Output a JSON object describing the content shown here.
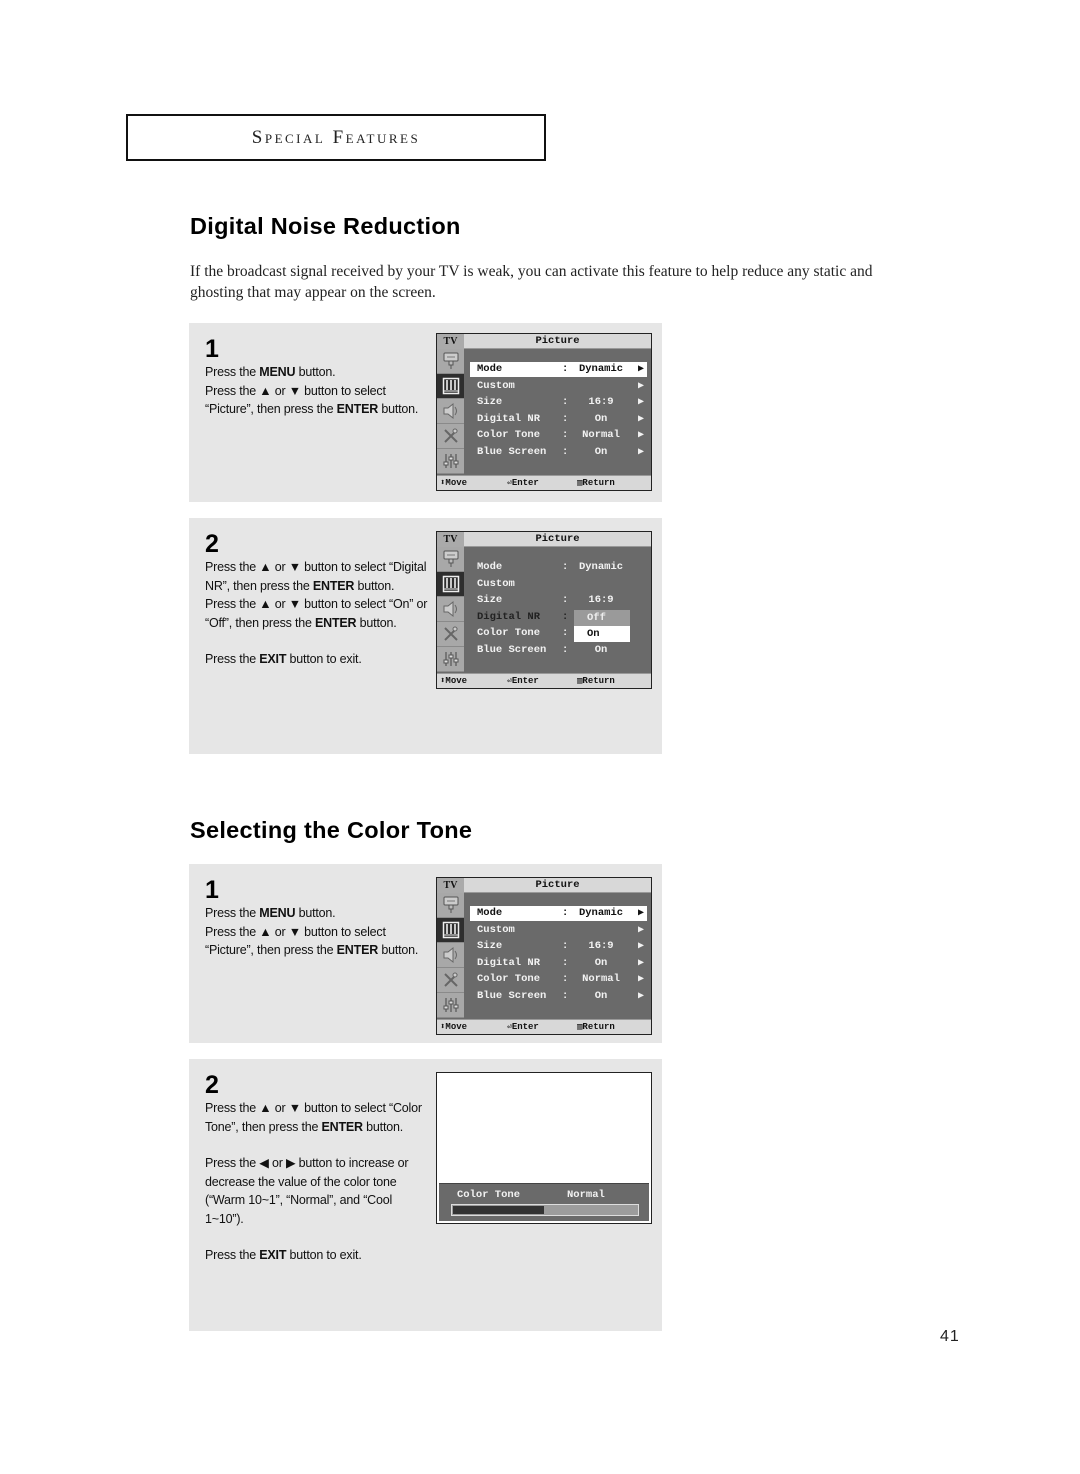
{
  "header": {
    "section": "Special Features"
  },
  "page_number": "41",
  "sections": [
    {
      "title": "Digital Noise Reduction",
      "intro": "If the broadcast signal received by your TV is weak, you can activate this feature to help reduce any static and ghosting that may appear on the screen.",
      "steps": [
        {
          "number": "1",
          "lines": [
            [
              "Press the ",
              {
                "b": "MENU"
              },
              " button."
            ],
            [
              "Press the ▲ or ▼ button to select “Picture”, then press the ",
              {
                "b": "ENTER"
              },
              " button."
            ]
          ],
          "osd": {
            "tv_label": "TV",
            "title": "Picture",
            "rows": [
              {
                "label": "Mode",
                "colon": ":",
                "value": "Dynamic",
                "arrow": "▶",
                "highlighted": true
              },
              {
                "label": "Custom",
                "colon": "",
                "value": "",
                "arrow": "▶"
              },
              {
                "label": "Size",
                "colon": ":",
                "value": "16:9",
                "arrow": "▶"
              },
              {
                "label": "Digital NR",
                "colon": ":",
                "value": "On",
                "arrow": "▶"
              },
              {
                "label": "Color Tone",
                "colon": ":",
                "value": "Normal",
                "arrow": "▶"
              },
              {
                "label": "Blue Screen",
                "colon": ":",
                "value": "On",
                "arrow": "▶"
              }
            ],
            "footer": {
              "move": "Move",
              "enter": "Enter",
              "return": "Return"
            }
          }
        },
        {
          "number": "2",
          "lines": [
            [
              "Press the ▲ or ▼ button to select “Digital NR”, then press the ",
              {
                "b": "ENTER"
              },
              " button."
            ],
            [
              "Press the ▲ or ▼ button to select “On” or “Off”, then press the ",
              {
                "b": "ENTER"
              },
              " button."
            ],
            [
              "GAP"
            ],
            [
              "Press the ",
              {
                "b": "EXIT"
              },
              " button to exit."
            ]
          ],
          "osd": {
            "tv_label": "TV",
            "title": "Picture",
            "rows": [
              {
                "label": "Mode",
                "colon": ":",
                "value": "Dynamic",
                "arrow": ""
              },
              {
                "label": "Custom",
                "colon": "",
                "value": "",
                "arrow": ""
              },
              {
                "label": "Size",
                "colon": ":",
                "value": "16:9",
                "arrow": ""
              },
              {
                "label": "Digital NR",
                "colon": ":",
                "value": "",
                "arrow": "",
                "dim": true
              },
              {
                "label": "Color Tone",
                "colon": ":",
                "value": "",
                "arrow": ""
              },
              {
                "label": "Blue Screen",
                "colon": ":",
                "value": "On",
                "arrow": ""
              }
            ],
            "dropdown": {
              "options": [
                "Off",
                "On"
              ],
              "selected": "On"
            },
            "footer": {
              "move": "Move",
              "enter": "Enter",
              "return": "Return"
            }
          }
        }
      ]
    },
    {
      "title": "Selecting the Color Tone",
      "steps": [
        {
          "number": "1",
          "lines": [
            [
              "Press the ",
              {
                "b": "MENU"
              },
              " button."
            ],
            [
              "Press the ▲ or ▼ button to select “Picture”, then press the ",
              {
                "b": "ENTER"
              },
              " button."
            ]
          ],
          "osd": {
            "tv_label": "TV",
            "title": "Picture",
            "rows": [
              {
                "label": "Mode",
                "colon": ":",
                "value": "Dynamic",
                "arrow": "▶",
                "highlighted": true
              },
              {
                "label": "Custom",
                "colon": "",
                "value": "",
                "arrow": "▶"
              },
              {
                "label": "Size",
                "colon": ":",
                "value": "16:9",
                "arrow": "▶"
              },
              {
                "label": "Digital NR",
                "colon": ":",
                "value": "On",
                "arrow": "▶"
              },
              {
                "label": "Color Tone",
                "colon": ":",
                "value": "Normal",
                "arrow": "▶"
              },
              {
                "label": "Blue Screen",
                "colon": ":",
                "value": "On",
                "arrow": "▶"
              }
            ],
            "footer": {
              "move": "Move",
              "enter": "Enter",
              "return": "Return"
            }
          }
        },
        {
          "number": "2",
          "lines": [
            [
              "Press the ▲ or ▼ button to select “Color Tone”, then press the ",
              {
                "b": "ENTER"
              },
              " button."
            ],
            [
              "GAP"
            ],
            [
              "Press the ◀ or ▶ button to increase or decrease the value of the color tone (“Warm 10~1”, “Normal”, and “Cool 1~10”)."
            ],
            [
              "GAP"
            ],
            [
              "Press the ",
              {
                "b": "EXIT"
              },
              " button to exit."
            ]
          ],
          "slider": {
            "label": "Color Tone",
            "value": "Normal",
            "fill_fraction": 0.5
          }
        }
      ]
    }
  ]
}
